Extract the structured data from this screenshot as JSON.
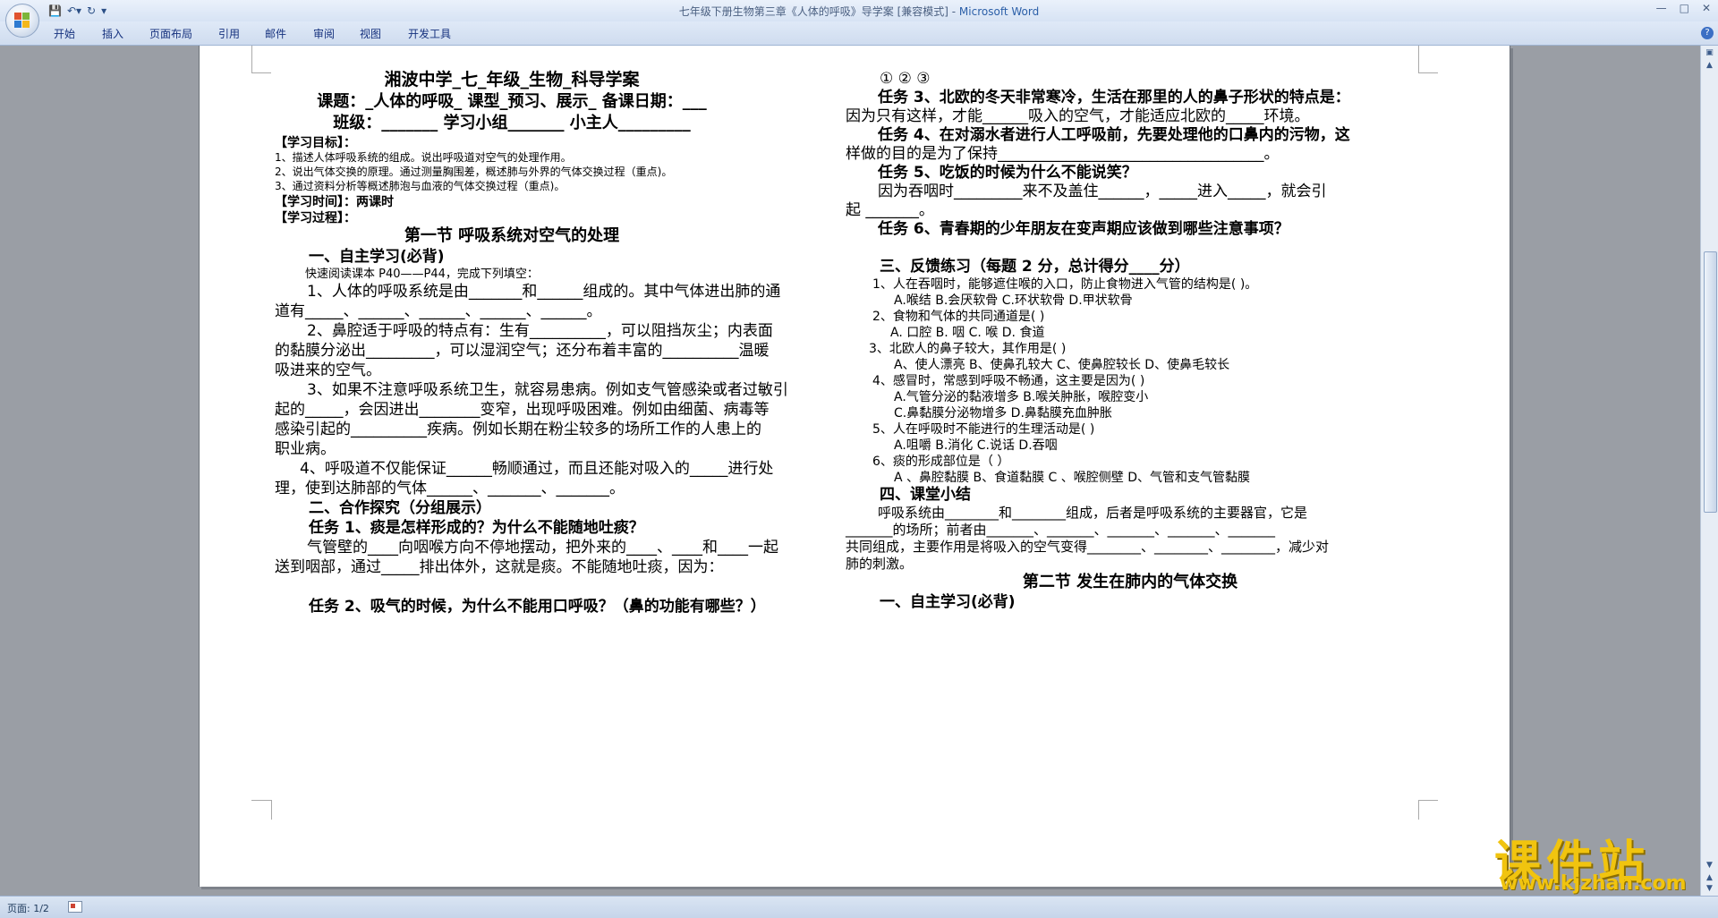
{
  "window": {
    "title": "七年级下册生物第三章《人体的呼吸》导学案 [兼容模式] - ",
    "app_name": "Microsoft Word"
  },
  "ribbon": {
    "tabs": [
      "开始",
      "插入",
      "页面布局",
      "引用",
      "邮件",
      "审阅",
      "视图",
      "开发工具"
    ]
  },
  "status": {
    "page": "页面: 1/2"
  },
  "watermark": {
    "brand": "课件站",
    "url": "www.kjzhan.com"
  },
  "left_column": [
    {
      "text": "湘波中学_七_年级_生物_科导学案",
      "size": 19,
      "bold": true,
      "center": true
    },
    {
      "text": "课题：_人体的呼吸_ 课型_预习、展示_ 备课日期：___",
      "size": 18,
      "bold": true,
      "center": true
    },
    {
      "text": "班级：_______ 学习小组_______ 小主人_________",
      "size": 18,
      "bold": true,
      "center": true
    },
    {
      "text": "【学习目标】：",
      "size": 14,
      "bold": true
    },
    {
      "text": "1、描述人体呼吸系统的组成。说出呼吸道对空气的处理作用。",
      "size": 12
    },
    {
      "text": "2、说出气体交换的原理。通过测量胸围差，概述肺与外界的气体交换过程（重点)。",
      "size": 12
    },
    {
      "text": "3、通过资料分析等概述肺泡与血液的气体交换过程（重点)。",
      "size": 12
    },
    {
      "text": "【学习时间】：两课时",
      "size": 14,
      "bold": true
    },
    {
      "text": "【学习过程】：",
      "size": 14,
      "bold": true
    },
    {
      "text": "第一节 呼吸系统对空气的处理",
      "size": 18,
      "bold": true,
      "center": true
    },
    {
      "text": "一、自主学习(必背)",
      "size": 17,
      "bold": true,
      "indent": 38
    },
    {
      "text": "快速阅读课本 P40——P44，完成下列填空：",
      "size": 13,
      "indent": 34
    },
    {
      "text": "1、人体的呼吸系统是由_______和______组成的。其中气体进出肺的通",
      "size": 17,
      "indent": 36
    },
    {
      "text": "道有_____、______、______、______、______。",
      "size": 17
    },
    {
      "text": "2、鼻腔适于呼吸的特点有：生有__________，可以阻挡灰尘；内表面",
      "size": 17,
      "indent": 36
    },
    {
      "text": "的黏膜分泌出_________，可以湿润空气；还分布着丰富的__________温暖",
      "size": 17
    },
    {
      "text": "吸进来的空气。",
      "size": 17
    },
    {
      "text": "3、如果不注意呼吸系统卫生，就容易患病。例如支气管感染或者过敏引",
      "size": 17,
      "indent": 36
    },
    {
      "text": "起的_____，会因进出________变窄，出现呼吸困难。例如由细菌、病毒等",
      "size": 17
    },
    {
      "text": "感染引起的__________疾病。例如长期在粉尘较多的场所工作的人患上的",
      "size": 17
    },
    {
      "text": "职业病。",
      "size": 17
    },
    {
      "text": "4、呼吸道不仅能保证______畅顺通过，而且还能对吸入的_____进行处",
      "size": 17,
      "indent": 28
    },
    {
      "text": "理，使到达肺部的气体______、_______、_______。",
      "size": 17
    },
    {
      "text": "二、合作探究（分组展示）",
      "size": 17,
      "bold": true,
      "indent": 38
    },
    {
      "text": "任务 1、痰是怎样形成的？为什么不能随地吐痰？",
      "size": 17,
      "bold": true,
      "indent": 38
    },
    {
      "text": "气管壁的____向咽喉方向不停地摆动，把外来的____、____和____一起",
      "size": 17,
      "indent": 36
    },
    {
      "text": "送到咽部，通过_____排出体外，这就是痰。不能随地吐痰，因为：",
      "size": 17
    },
    {
      "text": "",
      "size": 17
    },
    {
      "text": "任务 2、吸气的时候，为什么不能用口呼吸？（鼻的功能有哪些？）",
      "size": 17,
      "bold": true,
      "indent": 38
    }
  ],
  "right_column": [
    {
      "text": "①       ②       ③",
      "size": 17,
      "indent": 38
    },
    {
      "text": "任务 3、北欧的冬天非常寒冷，生活在那里的人的鼻子形状的特点是：",
      "size": 17,
      "bold": true,
      "indent": 36
    },
    {
      "text": "因为只有这样，才能______吸入的空气，才能适应北欧的_____环境。",
      "size": 17
    },
    {
      "text": "任务 4、在对溺水者进行人工呼吸前，先要处理他的口鼻内的污物，这",
      "size": 17,
      "bold": true,
      "indent": 36
    },
    {
      "text": "样做的目的是为了保持___________________________________。",
      "size": 17
    },
    {
      "text": "任务 5、吃饭的时候为什么不能说笑？",
      "size": 17,
      "bold": true,
      "indent": 36
    },
    {
      "text": "因为吞咽时_________来不及盖住______，_____进入_____，就会引",
      "size": 17,
      "indent": 36
    },
    {
      "text": "起 _______。",
      "size": 17
    },
    {
      "text": "任务 6、青春期的少年朋友在变声期应该做到哪些注意事项？",
      "size": 17,
      "bold": true,
      "indent": 36
    },
    {
      "text": "",
      "size": 17
    },
    {
      "text": "三、反馈练习（每题 2 分，总计得分____分）",
      "size": 17,
      "bold": true,
      "indent": 38
    },
    {
      "text": "1、人在吞咽时，能够遮住喉的入口，防止食物进入气管的结构是(    )。",
      "size": 14,
      "indent": 30
    },
    {
      "text": "A.喉结   B.会厌软骨   C.环状软骨   D.甲状软骨",
      "size": 14,
      "indent": 54
    },
    {
      "text": "2、食物和气体的共同通道是(     )",
      "size": 14,
      "indent": 30
    },
    {
      "text": "A. 口腔      B. 咽        C. 喉        D. 食道",
      "size": 14,
      "indent": 50
    },
    {
      "text": "3、北欧人的鼻子较大，其作用是(    )",
      "size": 14,
      "indent": 26
    },
    {
      "text": "A、使人漂亮  B、使鼻孔较大  C、使鼻腔较长  D、使鼻毛较长",
      "size": 14,
      "indent": 54
    },
    {
      "text": "4、感冒时，常感到呼吸不畅通，这主要是因为(    )",
      "size": 14,
      "indent": 30
    },
    {
      "text": "A.气管分泌的黏液增多    B.喉关肿胀，喉腔变小",
      "size": 14,
      "indent": 54
    },
    {
      "text": "C.鼻黏膜分泌物增多      D.鼻黏膜充血肿胀",
      "size": 14,
      "indent": 54
    },
    {
      "text": "5、人在呼吸时不能进行的生理活动是(   )",
      "size": 14,
      "indent": 30
    },
    {
      "text": "A.咀嚼    B.消化    C.说话    D.吞咽",
      "size": 14,
      "indent": 54
    },
    {
      "text": "6、痰的形成部位是（       ）",
      "size": 14,
      "indent": 30
    },
    {
      "text": "A 、鼻腔黏膜   B、食道黏膜    C 、喉腔侧壁    D、气管和支气管黏膜",
      "size": 14,
      "indent": 54
    },
    {
      "text": "四、课堂小结",
      "size": 17,
      "bold": true,
      "indent": 38
    },
    {
      "text": "呼吸系统由________和________组成，后者是呼吸系统的主要器官，它是",
      "size": 15,
      "indent": 36
    },
    {
      "text": "_______的场所；前者由_______、_______、_______、_______、_______",
      "size": 15
    },
    {
      "text": "共同组成，主要作用是将吸入的空气变得________、________、________，减少对",
      "size": 15
    },
    {
      "text": "肺的刺激。",
      "size": 15
    },
    {
      "text": "第二节 发生在肺内的气体交换",
      "size": 18,
      "bold": true,
      "center": true
    },
    {
      "text": "一、自主学习(必背)",
      "size": 17,
      "bold": true,
      "indent": 38
    }
  ]
}
